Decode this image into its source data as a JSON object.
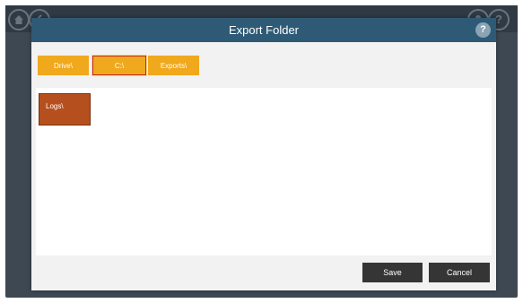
{
  "dialog": {
    "title": "Export Folder",
    "help_label": "?"
  },
  "breadcrumbs": [
    {
      "label": "Drive\\"
    },
    {
      "label": "C:\\"
    },
    {
      "label": "Exports\\"
    }
  ],
  "folders": [
    {
      "label": "Logs\\"
    }
  ],
  "footer": {
    "save_label": "Save",
    "cancel_label": "Cancel"
  },
  "background": {
    "help_label": "?"
  },
  "icons": {
    "home": "home-icon",
    "back": "back-icon",
    "user": "user-icon",
    "help": "help-icon"
  },
  "colors": {
    "dialog_header": "#2e5a76",
    "breadcrumb": "#f0a81c",
    "breadcrumb_selected_border": "#c0281b",
    "folder_tile": "#b5501e",
    "footer_button": "#353535"
  }
}
